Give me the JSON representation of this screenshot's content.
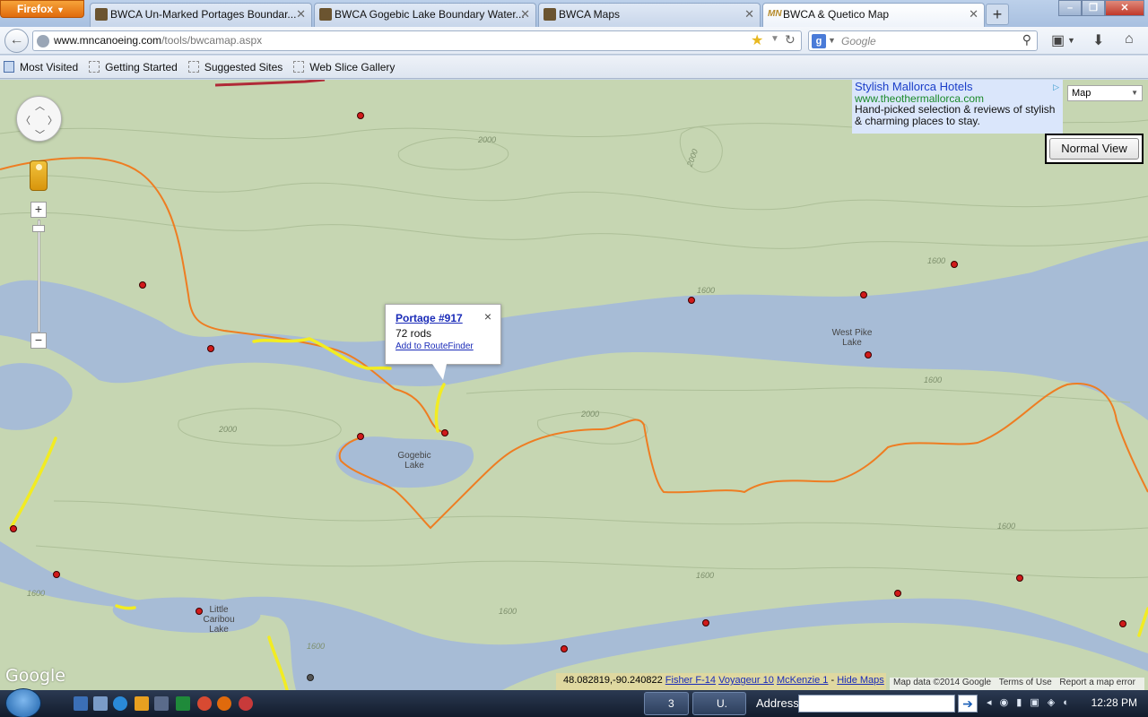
{
  "browser": {
    "menu_button": "Firefox",
    "tabs": [
      {
        "label": "BWCA Un-Marked Portages Boundar..."
      },
      {
        "label": "BWCA Gogebic Lake Boundary Water..."
      },
      {
        "label": "BWCA Maps"
      },
      {
        "label": "BWCA & Quetico Map"
      }
    ],
    "url_host": "www.mncanoeing.com",
    "url_path": "/tools/bwcamap.aspx",
    "search_placeholder": "Google",
    "bookmarks": [
      "Most Visited",
      "Getting Started",
      "Suggested Sites",
      "Web Slice Gallery"
    ]
  },
  "map": {
    "ad": {
      "title": "Stylish Mallorca Hotels",
      "url": "www.theothermallorca.com",
      "text": "Hand-picked selection & reviews of stylish & charming places to stay."
    },
    "map_type_select": "Map",
    "normal_view_button": "Normal View",
    "zoom_in": "+",
    "zoom_out": "−",
    "labels": {
      "west_pike_lake": "West Pike Lake",
      "gogebic_lake": "Gogebic Lake",
      "little_caribou_lake": "Little Caribou Lake"
    },
    "elevations": [
      "2000",
      "2000",
      "2000",
      "1600",
      "1600",
      "1600",
      "1600",
      "1600",
      "1600",
      "1600",
      "2000",
      "1600"
    ],
    "info_window": {
      "title": "Portage #917",
      "length": "72 rods",
      "link": "Add to RouteFinder",
      "close": "×"
    },
    "google_logo": "Google",
    "coords": "48.082819,-90.240822",
    "map_links": [
      "Fisher F-14",
      "Voyageur 10",
      "McKenzie 1"
    ],
    "link_separator": " - ",
    "hide_maps": "Hide Maps",
    "attribution": [
      "Map data ©2014 Google",
      "Terms of Use",
      "Report a map error"
    ]
  },
  "taskbar": {
    "firefox_count": "3",
    "second_window": "U.",
    "address_label": "Address",
    "clock": "12:28 PM"
  }
}
